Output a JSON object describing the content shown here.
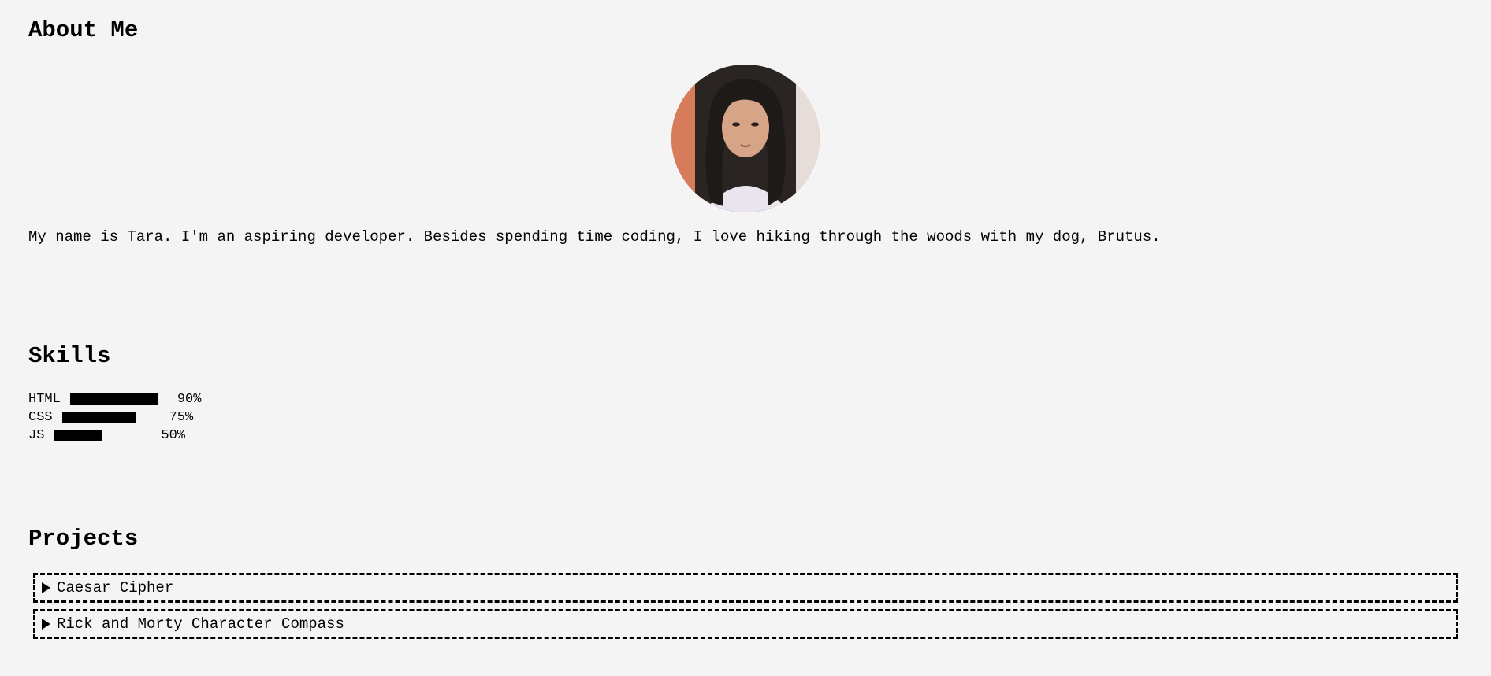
{
  "about": {
    "heading": "About Me",
    "bio": "My name is Tara. I'm an aspiring developer. Besides spending time coding, I love hiking through the woods with my dog, Brutus."
  },
  "skills": {
    "heading": "Skills",
    "items": [
      {
        "label": "HTML",
        "percent_text": "90%",
        "level": 0.9
      },
      {
        "label": "CSS",
        "percent_text": "75%",
        "level": 0.75
      },
      {
        "label": "JS",
        "percent_text": "50%",
        "level": 0.5
      }
    ]
  },
  "projects": {
    "heading": "Projects",
    "items": [
      {
        "title": "Caesar Cipher"
      },
      {
        "title": "Rick and Morty Character Compass"
      }
    ]
  },
  "colors": {
    "background": "#f4f4f4",
    "text": "#000000",
    "bar": "#000000"
  }
}
